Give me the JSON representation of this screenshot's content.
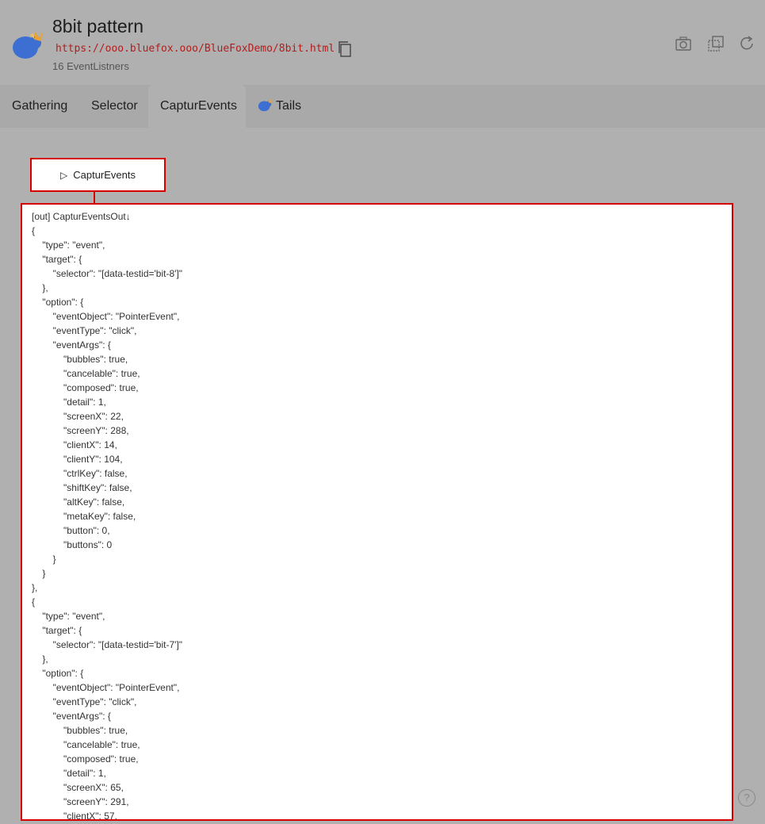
{
  "header": {
    "title": "8bit pattern",
    "url": "https://ooo.bluefox.ooo/BlueFoxDemo/8bit.html",
    "listeners": "16 EventListners"
  },
  "toolbar": {
    "icons": [
      "camera-icon",
      "screenshot-select-icon",
      "reload-icon"
    ]
  },
  "tabs": [
    {
      "label": "Gathering",
      "active": false
    },
    {
      "label": "Selector",
      "active": false
    },
    {
      "label": "CapturEvents",
      "active": true
    },
    {
      "label": "Tails",
      "active": false
    }
  ],
  "action": {
    "run_label": "CapturEvents"
  },
  "output": {
    "lines": [
      "[out] CapturEventsOut↓",
      "{",
      "    \"type\": \"event\",",
      "    \"target\": {",
      "        \"selector\": \"[data-testid='bit-8']\"",
      "    },",
      "    \"option\": {",
      "        \"eventObject\": \"PointerEvent\",",
      "        \"eventType\": \"click\",",
      "        \"eventArgs\": {",
      "            \"bubbles\": true,",
      "            \"cancelable\": true,",
      "            \"composed\": true,",
      "            \"detail\": 1,",
      "            \"screenX\": 22,",
      "            \"screenY\": 288,",
      "            \"clientX\": 14,",
      "            \"clientY\": 104,",
      "            \"ctrlKey\": false,",
      "            \"shiftKey\": false,",
      "            \"altKey\": false,",
      "            \"metaKey\": false,",
      "            \"button\": 0,",
      "            \"buttons\": 0",
      "        }",
      "    }",
      "},",
      "{",
      "    \"type\": \"event\",",
      "    \"target\": {",
      "        \"selector\": \"[data-testid='bit-7']\"",
      "    },",
      "    \"option\": {",
      "        \"eventObject\": \"PointerEvent\",",
      "        \"eventType\": \"click\",",
      "        \"eventArgs\": {",
      "            \"bubbles\": true,",
      "            \"cancelable\": true,",
      "            \"composed\": true,",
      "            \"detail\": 1,",
      "            \"screenX\": 65,",
      "            \"screenY\": 291,",
      "            \"clientX\": 57,"
    ]
  },
  "help": {
    "label": "?"
  },
  "colors": {
    "accent": "#d40000",
    "url": "#b31c1c",
    "logo_blue": "#3c6fd1",
    "logo_orange": "#e8a23a"
  }
}
